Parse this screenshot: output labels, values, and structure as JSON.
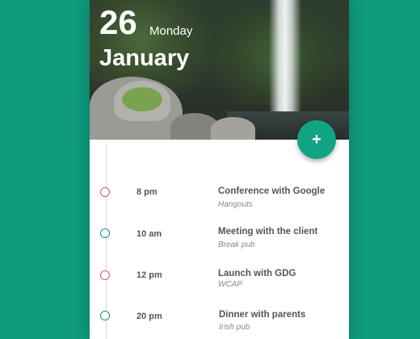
{
  "date": {
    "day": "26",
    "weekday": "Monday",
    "month": "January"
  },
  "fab": {
    "label": "+"
  },
  "colors": {
    "background": "#0f9b7d",
    "accent": "#12a383",
    "dot_red": "#e05555",
    "dot_green": "#15927a"
  },
  "events": [
    {
      "time": "8 pm",
      "title": "Conference with Google",
      "location": "Hangouts",
      "dot": "red"
    },
    {
      "time": "10 am",
      "title": "Meeting with the client",
      "location": "Break pub",
      "dot": "green"
    },
    {
      "time": "12 pm",
      "title": "Launch with GDG",
      "location": "WCAP",
      "dot": "red"
    },
    {
      "time": "20 pm",
      "title": "Dinner with parents",
      "location": "Irish pub",
      "dot": "green"
    }
  ]
}
